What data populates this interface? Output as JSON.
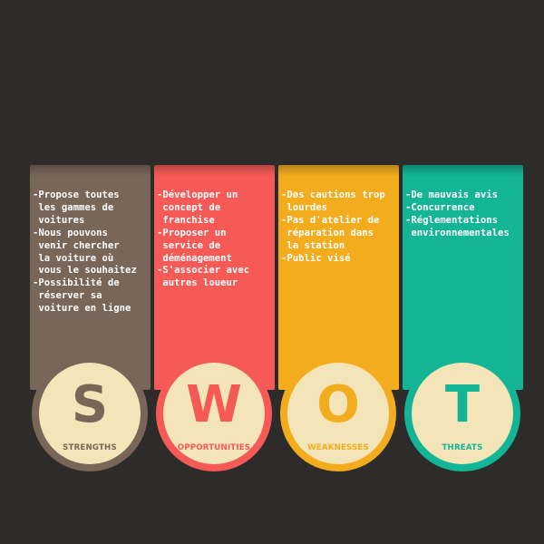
{
  "colors": {
    "background": "#2e2c2a",
    "strengths": "#786659",
    "opportunities": "#f55a57",
    "weaknesses": "#f2ac1e",
    "threats": "#13b596",
    "badge_ring": "#f3e5b8"
  },
  "quadrants": [
    {
      "key": "strengths",
      "letter": "S",
      "label": "STRENGTHS",
      "lines": [
        "-Propose toutes",
        " les gammes de",
        " voitures",
        "-Nous pouvons",
        " venir chercher",
        " la voiture où",
        " vous le souhaitez",
        "-Possibilité de",
        " réserver sa",
        " voiture en ligne"
      ]
    },
    {
      "key": "opportunities",
      "letter": "W",
      "label": "OPPORTUNITIES",
      "lines": [
        "-Développer un",
        " concept de",
        " franchise",
        "-Proposer un",
        " service de",
        " déménagement",
        "-S'associer avec",
        " autres loueur"
      ]
    },
    {
      "key": "weaknesses",
      "letter": "O",
      "label": "WEAKNESSES",
      "lines": [
        "-Des cautions trop",
        " lourdes",
        "-Pas d'atelier de",
        " réparation dans",
        " la station",
        "-Public visé"
      ]
    },
    {
      "key": "threats",
      "letter": "T",
      "label": "THREATS",
      "lines": [
        "-De mauvais avis",
        "-Concurrence",
        "-Réglementations",
        " environnementales"
      ]
    }
  ]
}
